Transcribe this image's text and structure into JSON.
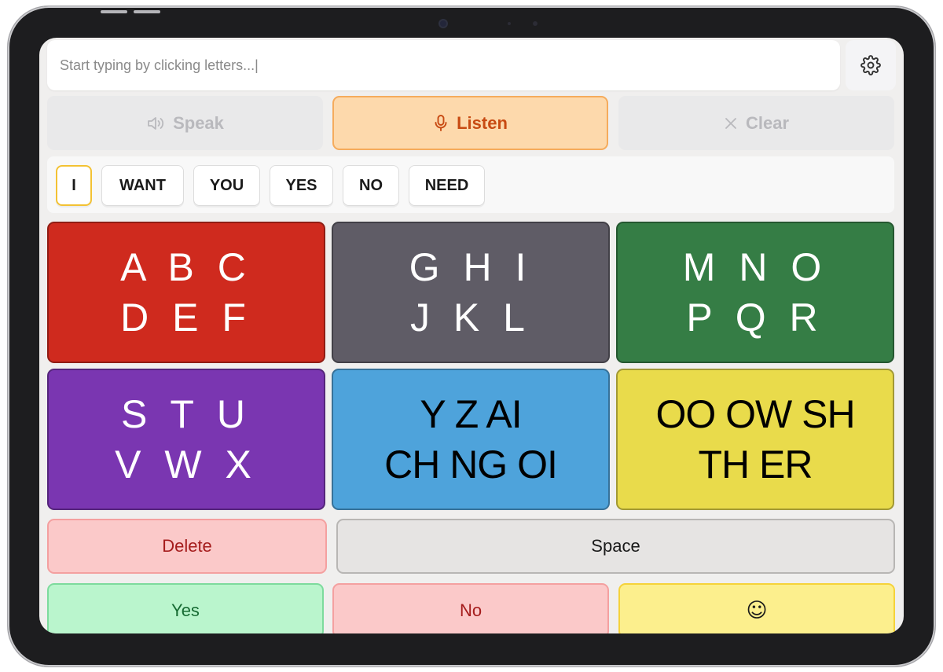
{
  "input": {
    "placeholder": "Start typing by clicking letters...|",
    "value": ""
  },
  "actions": {
    "speak": "Speak",
    "listen": "Listen",
    "clear": "Clear"
  },
  "quick_words": [
    "I",
    "WANT",
    "YOU",
    "YES",
    "NO",
    "NEED"
  ],
  "letter_groups": [
    {
      "line1": "A B C",
      "line2": "D E F",
      "color": "#cf2a1e",
      "text_color": "#ffffff"
    },
    {
      "line1": "G H I",
      "line2": "J K L",
      "color": "#5f5c66",
      "text_color": "#ffffff"
    },
    {
      "line1": "M N O",
      "line2": "P Q R",
      "color": "#357d45",
      "text_color": "#ffffff"
    },
    {
      "line1": "S T U",
      "line2": "V W X",
      "color": "#7a36b1",
      "text_color": "#ffffff"
    },
    {
      "line1": "Y Z AI",
      "line2": "CH NG OI",
      "color": "#4ea3db",
      "text_color": "#000000"
    },
    {
      "line1": "OO OW SH",
      "line2": "TH ER",
      "color": "#e9db4b",
      "text_color": "#000000"
    }
  ],
  "controls": {
    "delete": "Delete",
    "space": "Space",
    "yes": "Yes",
    "no": "No",
    "emoji": "☺"
  },
  "icons": {
    "settings": "gear-icon",
    "speak": "speaker-icon",
    "listen": "microphone-icon",
    "clear": "close-icon"
  },
  "colors": {
    "selected_word_border": "#f3c233",
    "listen_accent": "#c84a12"
  }
}
